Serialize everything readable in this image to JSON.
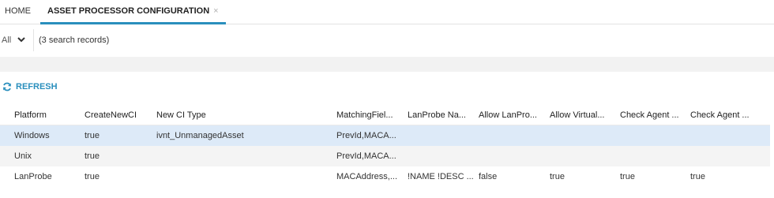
{
  "tabs": [
    {
      "label": "HOME"
    },
    {
      "label": "ASSET PROCESSOR CONFIGURATION",
      "close": "×"
    }
  ],
  "filter": {
    "selected": "All",
    "record_count": "(3 search records)"
  },
  "toolbar": {
    "refresh_label": "REFRESH"
  },
  "colors": {
    "accent": "#2a8fbd",
    "selected_row": "#ddeaf8",
    "alt_row": "#f4f4f4",
    "band": "#f2f2f2"
  },
  "grid": {
    "columns": [
      "Platform",
      "CreateNewCI",
      "New CI Type",
      "MatchingFiel...",
      "LanProbe Na...",
      "Allow LanPro...",
      "Allow Virtual...",
      "Check Agent ...",
      "Check Agent ..."
    ],
    "rows": [
      [
        "Windows",
        "true",
        "ivnt_UnmanagedAsset",
        "PrevId,MACA...",
        "",
        "",
        "",
        "",
        ""
      ],
      [
        "Unix",
        "true",
        "",
        "PrevId,MACA...",
        "",
        "",
        "",
        "",
        ""
      ],
      [
        "LanProbe",
        "true",
        "",
        "MACAddress,...",
        "!NAME !DESC ...",
        "false",
        "true",
        "true",
        "true"
      ]
    ]
  }
}
